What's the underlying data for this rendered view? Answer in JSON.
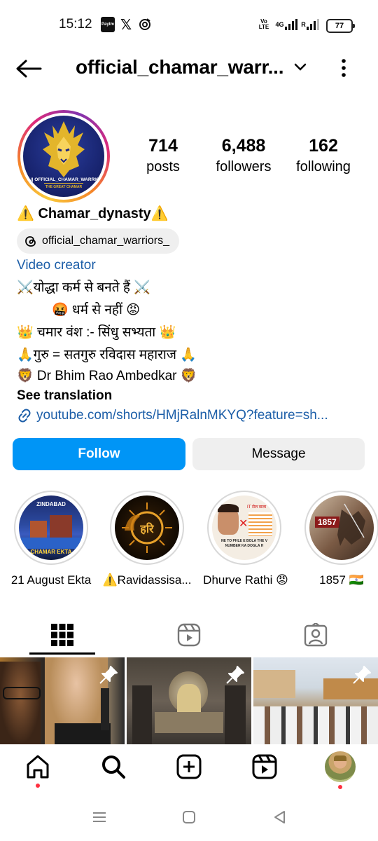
{
  "status_bar": {
    "time": "15:12",
    "paytm": "Paytm",
    "x_app": "𝕏",
    "volte": "Vo LTE",
    "net": "4G",
    "battery": "77"
  },
  "header": {
    "username": "official_chamar_warr..."
  },
  "profile": {
    "avatar_text": "IG || OFFICIAL_CHAMAR_WARRIOR",
    "avatar_sub": "THE GREAT CHAMAR",
    "stats": [
      {
        "value": "714",
        "label": "posts"
      },
      {
        "value": "6,488",
        "label": "followers"
      },
      {
        "value": "162",
        "label": "following"
      }
    ],
    "name": "⚠️ Chamar_dynasty⚠️",
    "threads_handle": "official_chamar_warriors_",
    "category": "Video creator",
    "bio_lines": [
      "⚔️योद्धा कर्म से बनते हैं ⚔️",
      "🤬 धर्म से नहीं 😡",
      "👑 चमार वंश :- सिंधु सभ्यता 👑",
      "🙏गुरु = सतगुरु रविदास महाराज 🙏",
      "🦁 Dr Bhim Rao Ambedkar 🦁"
    ],
    "see_translation": "See translation",
    "link": "youtube.com/shorts/HMjRalnMKYQ?feature=sh..."
  },
  "actions": {
    "follow": "Follow",
    "message": "Message"
  },
  "highlights": [
    {
      "label": "21 August Ekta",
      "thumb_text_top": "ZINDABAD",
      "thumb_text_bottom": "CHAMAR EKTA"
    },
    {
      "label": "⚠️Ravidassisa...",
      "thumb_text": "हरि"
    },
    {
      "label": "Dhurve Rathi 😡",
      "thumb_text": "IT सेल वाला",
      "thumb_caption": "NE TO PHLE E BOLA THE V NUMBER KA DOGLA H"
    },
    {
      "label": "1857 🇮🇳",
      "thumb_text": "1857"
    }
  ],
  "tabs": [
    "grid",
    "reels",
    "tagged"
  ],
  "colors": {
    "accent": "#0095f6",
    "link": "#1c5ea8",
    "notification": "#ff3040"
  }
}
